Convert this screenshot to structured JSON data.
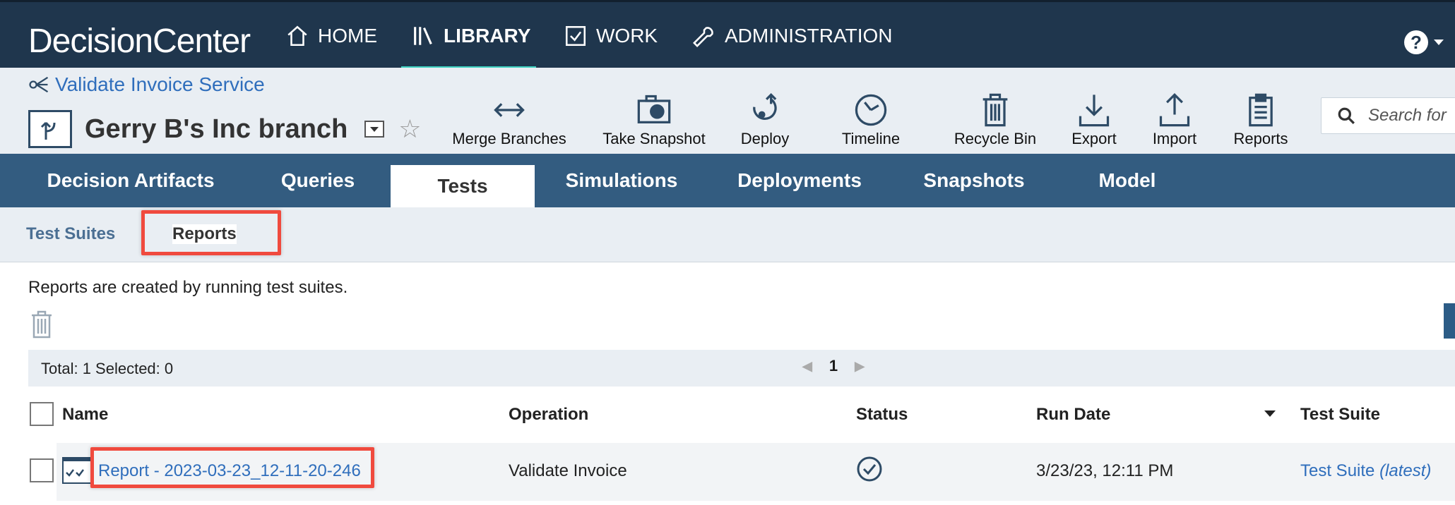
{
  "app": {
    "brand": "DecisionCenter",
    "nav": [
      {
        "label": "HOME",
        "icon": "home-icon"
      },
      {
        "label": "LIBRARY",
        "icon": "library-icon"
      },
      {
        "label": "WORK",
        "icon": "checkbox-icon"
      },
      {
        "label": "ADMINISTRATION",
        "icon": "wrench-icon"
      }
    ],
    "help_glyph": "?"
  },
  "branch": {
    "project_link": "Validate Invoice Service",
    "name": "Gerry B's Inc branch"
  },
  "toolbar": [
    {
      "label": "Merge Branches",
      "icon": "merge-arrows-icon"
    },
    {
      "label": "Take Snapshot",
      "icon": "camera-icon"
    },
    {
      "label": "Deploy",
      "icon": "deploy-icon"
    },
    {
      "label": "Timeline",
      "icon": "clock-icon"
    },
    {
      "label": "Recycle Bin",
      "icon": "trash-icon"
    },
    {
      "label": "Export",
      "icon": "export-icon"
    },
    {
      "label": "Import",
      "icon": "import-icon"
    },
    {
      "label": "Reports",
      "icon": "clipboard-icon"
    }
  ],
  "search": {
    "placeholder": "Search for"
  },
  "tabs": [
    "Decision Artifacts",
    "Queries",
    "Tests",
    "Simulations",
    "Deployments",
    "Snapshots",
    "Model"
  ],
  "active_tab": "Tests",
  "subtabs": [
    "Test Suites",
    "Reports"
  ],
  "active_subtab": "Reports",
  "content": {
    "intro": "Reports are created by running test suites.",
    "total_selected": "Total: 1 Selected: 0",
    "page": "1"
  },
  "table": {
    "columns": [
      "Name",
      "Operation",
      "Status",
      "Run Date",
      "Test Suite"
    ],
    "rows": [
      {
        "name": "Report - 2023-03-23_12-11-20-246",
        "operation": "Validate Invoice",
        "status": "passed",
        "run_date": "3/23/23, 12:11 PM",
        "test_suite": "Test Suite",
        "test_suite_version": "(latest)"
      }
    ]
  },
  "colors": {
    "nav_bg": "#1f364d",
    "tab_bg": "#335c80",
    "accent": "#3ed2c1",
    "link": "#2f6ebc",
    "highlight": "#f04a3e"
  }
}
